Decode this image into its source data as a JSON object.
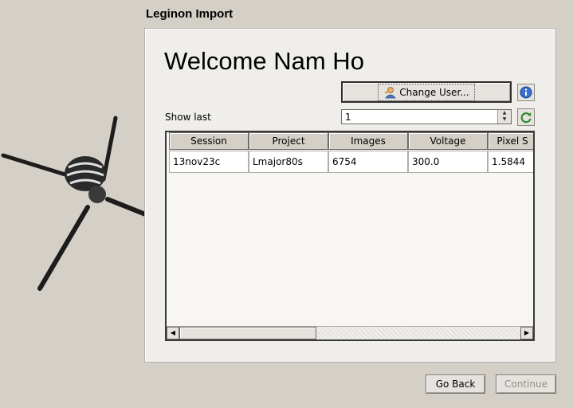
{
  "section_title": "Leginon Import",
  "welcome_text": "Welcome Nam Ho",
  "change_user_label": "Change User...",
  "show_last": {
    "label": "Show last",
    "value": "1"
  },
  "table": {
    "headers": [
      "Session",
      "Project",
      "Images",
      "Voltage",
      "Pixel S"
    ],
    "rows": [
      [
        "13nov23c",
        "Lmajor80s",
        "6754",
        "300.0",
        "1.5844"
      ]
    ]
  },
  "buttons": {
    "go_back": "Go Back",
    "continue": "Continue"
  },
  "icons": {
    "info": "info-icon",
    "refresh": "refresh-icon",
    "user": "user-icon"
  }
}
